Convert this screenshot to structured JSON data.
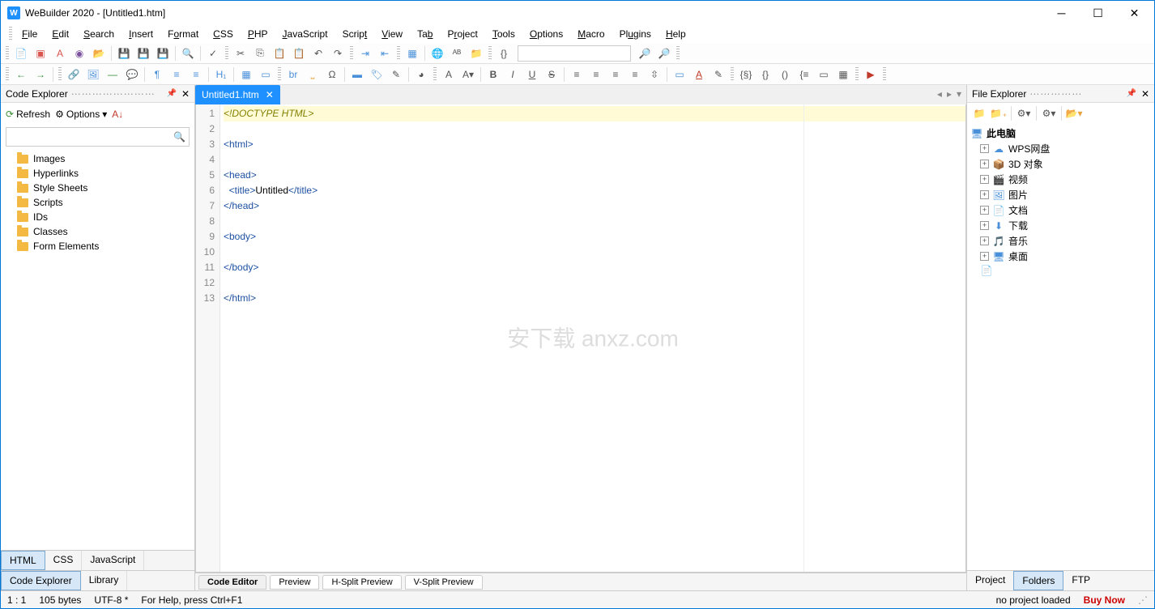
{
  "titlebar": {
    "title": "WeBuilder 2020 - [Untitled1.htm]"
  },
  "menus": [
    "File",
    "Edit",
    "Search",
    "Insert",
    "Format",
    "CSS",
    "PHP",
    "JavaScript",
    "Script",
    "View",
    "Tab",
    "Project",
    "Tools",
    "Options",
    "Macro",
    "Plugins",
    "Help"
  ],
  "codeExplorer": {
    "title": "Code Explorer",
    "refresh": "Refresh",
    "options": "Options",
    "items": [
      "Images",
      "Hyperlinks",
      "Style Sheets",
      "Scripts",
      "IDs",
      "Classes",
      "Form Elements"
    ]
  },
  "leftTabs": {
    "lang": [
      "HTML",
      "CSS",
      "JavaScript"
    ],
    "bottom": [
      "Code Explorer",
      "Library"
    ]
  },
  "docTab": {
    "name": "Untitled1.htm"
  },
  "editor": {
    "lines": [
      {
        "n": 1,
        "type": "doctype",
        "text": "<!DOCTYPE HTML>"
      },
      {
        "n": 2,
        "type": "blank",
        "text": ""
      },
      {
        "n": 3,
        "type": "tag",
        "text": "<html>"
      },
      {
        "n": 4,
        "type": "blank",
        "text": ""
      },
      {
        "n": 5,
        "type": "tag",
        "text": "<head>"
      },
      {
        "n": 6,
        "type": "title",
        "open": "  <title>",
        "body": "Untitled",
        "close": "</title>"
      },
      {
        "n": 7,
        "type": "tag",
        "text": "</head>"
      },
      {
        "n": 8,
        "type": "blank",
        "text": ""
      },
      {
        "n": 9,
        "type": "tag",
        "text": "<body>"
      },
      {
        "n": 10,
        "type": "blank",
        "text": ""
      },
      {
        "n": 11,
        "type": "tag",
        "text": "</body>"
      },
      {
        "n": 12,
        "type": "blank",
        "text": ""
      },
      {
        "n": 13,
        "type": "tag",
        "text": "</html>"
      }
    ]
  },
  "editorTabs": [
    "Code Editor",
    "Preview",
    "H-Split Preview",
    "V-Split Preview"
  ],
  "fileExplorer": {
    "title": "File Explorer",
    "root": "此电脑",
    "items": [
      {
        "label": "WPS网盘",
        "kind": "cloud"
      },
      {
        "label": "3D 对象",
        "kind": "box"
      },
      {
        "label": "视频",
        "kind": "video"
      },
      {
        "label": "图片",
        "kind": "image"
      },
      {
        "label": "文档",
        "kind": "doc"
      },
      {
        "label": "下载",
        "kind": "download"
      },
      {
        "label": "音乐",
        "kind": "music"
      },
      {
        "label": "桌面",
        "kind": "desktop"
      }
    ]
  },
  "rightTabs": [
    "Project",
    "Folders",
    "FTP"
  ],
  "status": {
    "pos": "1 : 1",
    "size": "105 bytes",
    "enc": "UTF-8 *",
    "help": "For Help, press Ctrl+F1",
    "proj": "no project loaded",
    "buy": "Buy Now"
  }
}
